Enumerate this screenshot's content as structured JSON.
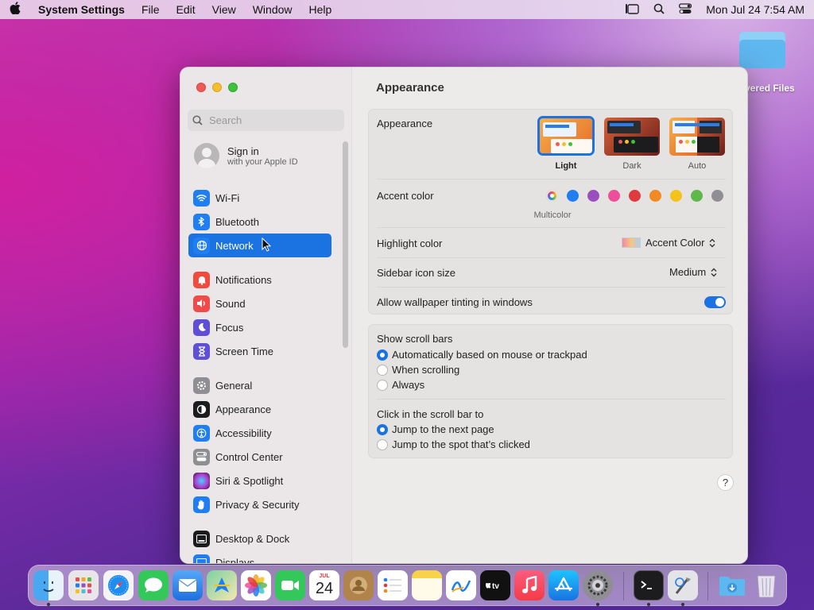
{
  "menubar": {
    "app": "System Settings",
    "menus": [
      "File",
      "Edit",
      "View",
      "Window",
      "Help"
    ],
    "clock": "Mon Jul 24  7:54 AM"
  },
  "desktop": {
    "folder_label": "vered Files"
  },
  "sidebar": {
    "search_placeholder": "Search",
    "signin_title": "Sign in",
    "signin_sub": "with your Apple ID",
    "items": [
      {
        "label": "Wi-Fi",
        "color": "#1f7ef2",
        "icon": "wifi-icon"
      },
      {
        "label": "Bluetooth",
        "color": "#1f7ef2",
        "icon": "bluetooth-icon"
      },
      {
        "label": "Network",
        "color": "#1f7ef2",
        "icon": "globe-icon"
      },
      {
        "label": "Notifications",
        "color": "#f04b3e",
        "icon": "bell-icon"
      },
      {
        "label": "Sound",
        "color": "#f04b4b",
        "icon": "speaker-icon"
      },
      {
        "label": "Focus",
        "color": "#5e4fd6",
        "icon": "moon-icon"
      },
      {
        "label": "Screen Time",
        "color": "#5e4fd6",
        "icon": "hourglass-icon"
      },
      {
        "label": "General",
        "color": "#8e8e93",
        "icon": "gear-icon"
      },
      {
        "label": "Appearance",
        "color": "#1c1c1e",
        "icon": "appearance-icon"
      },
      {
        "label": "Accessibility",
        "color": "#1f7ef2",
        "icon": "accessibility-icon"
      },
      {
        "label": "Control Center",
        "color": "#8e8e93",
        "icon": "control-center-icon"
      },
      {
        "label": "Siri & Spotlight",
        "color": "#b03cd0",
        "icon": "siri-icon"
      },
      {
        "label": "Privacy & Security",
        "color": "#1f7ef2",
        "icon": "hand-icon"
      },
      {
        "label": "Desktop & Dock",
        "color": "#1c1c1e",
        "icon": "dock-icon"
      },
      {
        "label": "Displays",
        "color": "#1f7ef2",
        "icon": "display-icon"
      }
    ]
  },
  "main": {
    "title": "Appearance",
    "appearance_label": "Appearance",
    "modes": [
      "Light",
      "Dark",
      "Auto"
    ],
    "accent_label": "Accent color",
    "accent_caption": "Multicolor",
    "accent_colors": [
      "#1f7ef2",
      "#9b4fbf",
      "#ee4f9a",
      "#e0393e",
      "#f08a24",
      "#f5c21b",
      "#5fb84a",
      "#8e8e93"
    ],
    "highlight_label": "Highlight color",
    "highlight_value": "Accent Color",
    "icon_size_label": "Sidebar icon size",
    "icon_size_value": "Medium",
    "tinting_label": "Allow wallpaper tinting in windows",
    "scroll_label": "Show scroll bars",
    "scroll_options": [
      "Automatically based on mouse or trackpad",
      "When scrolling",
      "Always"
    ],
    "click_label": "Click in the scroll bar to",
    "click_options": [
      "Jump to the next page",
      "Jump to the spot that’s clicked"
    ],
    "help": "?"
  },
  "dock": {
    "calendar_month": "JUL",
    "calendar_day": "24"
  }
}
